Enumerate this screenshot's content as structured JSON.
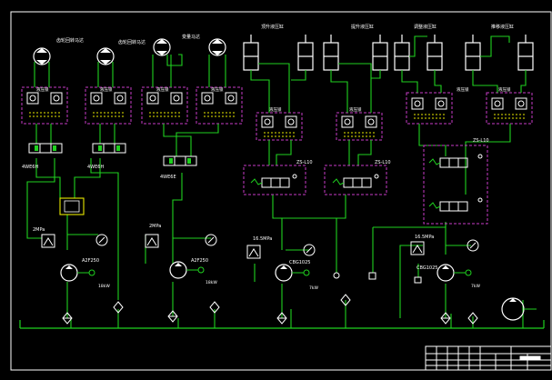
{
  "labels": {
    "motor1": "齿轮回转马达",
    "motor2": "齿轮回转马达",
    "motor3": "变量马达",
    "cyl1": "顶升液压缸",
    "cyl2": "提升液压缸",
    "cyl3": "调整液压缸",
    "cyl4": "推移液压缸",
    "lock1": "液压锁",
    "lock2": "液压锁",
    "lock3": "液压锁",
    "lock4": "液压锁",
    "lock5": "液压锁",
    "lock6": "液压锁",
    "lock7": "液压锁",
    "lock8": "液压锁",
    "valve1": "4WE6H",
    "valve2": "4WE6H",
    "valve3": "4WE6E",
    "zs1": "ZS-L10",
    "zs2": "ZS-L10",
    "zs3": "ZS-L10",
    "pr1": "2MPa",
    "pr2": "2MPa",
    "pr3": "16.5MPa",
    "pr4": "16.5MPa",
    "pump1": "A2F250",
    "pump2": "A2F250",
    "pump3": "CBG1025",
    "pump4": "CBG1025",
    "kw1": "18kW",
    "kw2": "18kW",
    "kw3": "7kW",
    "kw4": "7kW"
  }
}
